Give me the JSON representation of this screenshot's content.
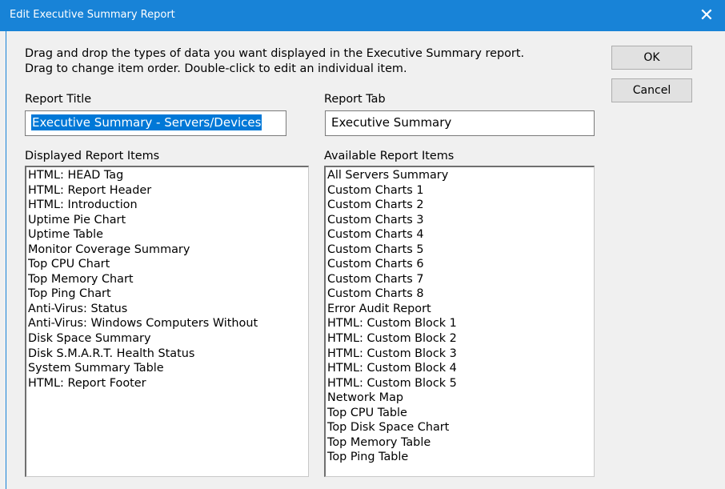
{
  "window": {
    "title": "Edit Executive Summary Report",
    "close_glyph": "✕"
  },
  "instructions": {
    "line1": "Drag and drop the types of data you want displayed in the Executive Summary report.",
    "line2": "Drag to change item order.  Double-click to edit an individual item."
  },
  "buttons": {
    "ok": "OK",
    "cancel": "Cancel"
  },
  "report_title": {
    "label": "Report Title",
    "value": "Executive Summary - Servers/Devices"
  },
  "report_tab": {
    "label": "Report Tab",
    "value": "Executive Summary"
  },
  "displayed_items": {
    "label": "Displayed Report Items",
    "items": [
      "HTML: HEAD Tag",
      "HTML: Report Header",
      "HTML: Introduction",
      "Uptime Pie Chart",
      "Uptime Table",
      "Monitor Coverage Summary",
      "Top CPU Chart",
      "Top Memory Chart",
      "Top Ping Chart",
      "Anti-Virus: Status",
      "Anti-Virus: Windows Computers Without",
      "Disk Space Summary",
      "Disk S.M.A.R.T. Health Status",
      "System Summary Table",
      "HTML: Report Footer"
    ]
  },
  "available_items": {
    "label": "Available Report Items",
    "items": [
      "All Servers Summary",
      "Custom Charts 1",
      "Custom Charts 2",
      "Custom Charts 3",
      "Custom Charts 4",
      "Custom Charts 5",
      "Custom Charts 6",
      "Custom Charts 7",
      "Custom Charts 8",
      "Error Audit Report",
      "HTML: Custom Block 1",
      "HTML: Custom Block 2",
      "HTML: Custom Block 3",
      "HTML: Custom Block 4",
      "HTML: Custom Block 5",
      "Network Map",
      "Top CPU Table",
      "Top Disk Space Chart",
      "Top Memory Table",
      "Top Ping Table"
    ]
  },
  "colors": {
    "titlebar": "#1883d7",
    "selection": "#0078d7",
    "dialog_background": "#f0f0f0"
  }
}
